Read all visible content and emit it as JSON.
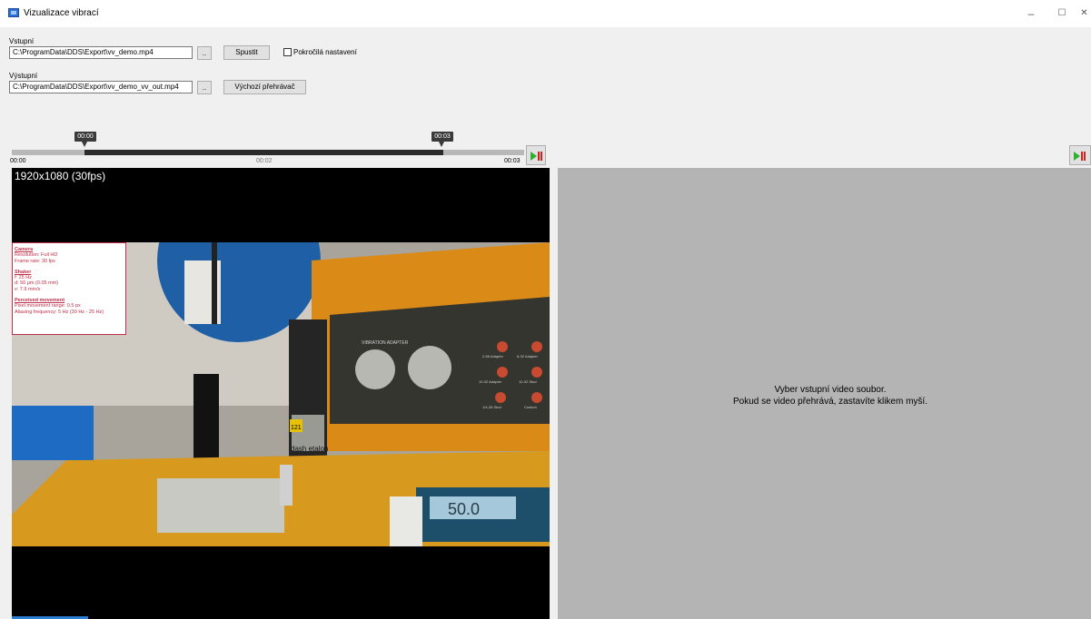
{
  "window": {
    "title": "Vizualizace vibrací",
    "minimize": "–",
    "maximize": "☐",
    "close": "✕"
  },
  "input": {
    "label": "Vstupní",
    "path": "C:\\ProgramData\\DDS\\Export\\vv_demo.mp4",
    "browse": "..",
    "run": "Spustit",
    "advanced": "Pokročilá nastavení"
  },
  "output": {
    "label": "Výstupní",
    "path": "C:\\ProgramData\\DDS\\Export\\vv_demo_vv_out.mp4",
    "browse": "..",
    "player": "Výchozí přehrávač"
  },
  "timeline": {
    "start_marker": "00:00",
    "end_marker": "00:03",
    "start": "00:00",
    "mid": "00:02",
    "end": "00:03"
  },
  "video": {
    "resolution": "1920x1080 (30fps)",
    "overlay": {
      "camera_h": "Camera",
      "camera_1": "Resolution: Full HD",
      "camera_2": "Frame rate: 30 fps",
      "shaker_h": "Shaker",
      "shaker_1": "f: 25 Hz",
      "shaker_2": "d: 50 μm (0.05 mm)",
      "shaker_3": "v: 7.9 mm/s",
      "move_h": "Perceived movement",
      "move_1": "Pixel movement range: 0.5 px",
      "move_2": "Aliasing frequency: 5 Hz (30 Hz - 25 Hz)"
    },
    "scene_text": {
      "adapter": "VIBRATION ADAPTER",
      "a1": "2-56 Adapter",
      "a2": "6-32 Adapter",
      "a3": "10-32 Adapter",
      "a4": "10-32 Stud",
      "a5": "1/4-28 Stud",
      "a6": "Custom",
      "etalon": "dash etalon",
      "num": "121",
      "display": "50.0"
    }
  },
  "right": {
    "line1": "Vyber vstupní video soubor.",
    "line2": "Pokud se video přehrává, zastavíte klikem myší."
  },
  "icons": {
    "app": "app-icon",
    "play_pause": "play-pause-icon"
  }
}
